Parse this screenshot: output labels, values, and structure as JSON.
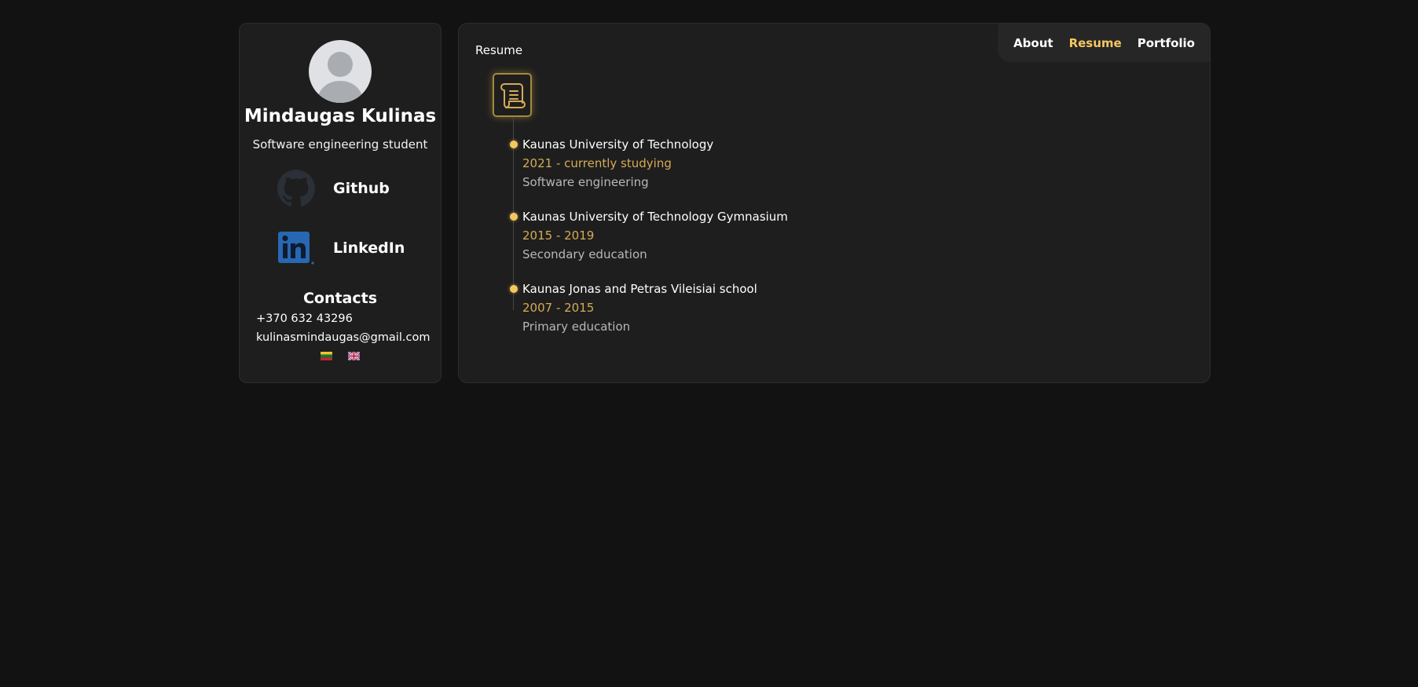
{
  "profile": {
    "name": "Mindaugas Kulinas",
    "role": "Software engineering student"
  },
  "social": {
    "github": {
      "label": "Github",
      "icon": "github-icon"
    },
    "linkedin": {
      "label": "LinkedIn",
      "icon": "linkedin-icon"
    }
  },
  "contacts": {
    "title": "Contacts",
    "phone": "+370 632 43296",
    "email": "kulinasmindaugas@gmail.com"
  },
  "languages": [
    {
      "icon": "flag-lithuania-icon"
    },
    {
      "icon": "flag-uk-icon"
    }
  ],
  "nav": {
    "items": [
      {
        "label": "About",
        "active": false
      },
      {
        "label": "Resume",
        "active": true
      },
      {
        "label": "Portfolio",
        "active": false
      }
    ]
  },
  "page": {
    "title": "Resume",
    "icon": "scroll-icon"
  },
  "education": [
    {
      "school": "Kaunas University of Technology",
      "period": "2021 - currently studying",
      "description": "Software engineering"
    },
    {
      "school": "Kaunas University of Technology Gymnasium",
      "period": "2015 - 2019",
      "description": "Secondary education"
    },
    {
      "school": "Kaunas Jonas and Petras Vileisiai school",
      "period": "2007 - 2015",
      "description": "Primary education"
    }
  ],
  "colors": {
    "background": "#121212",
    "card": "#1e1e1e",
    "accent": "#f6c760",
    "period": "#d6ab55",
    "muted": "#b8b8b8"
  }
}
